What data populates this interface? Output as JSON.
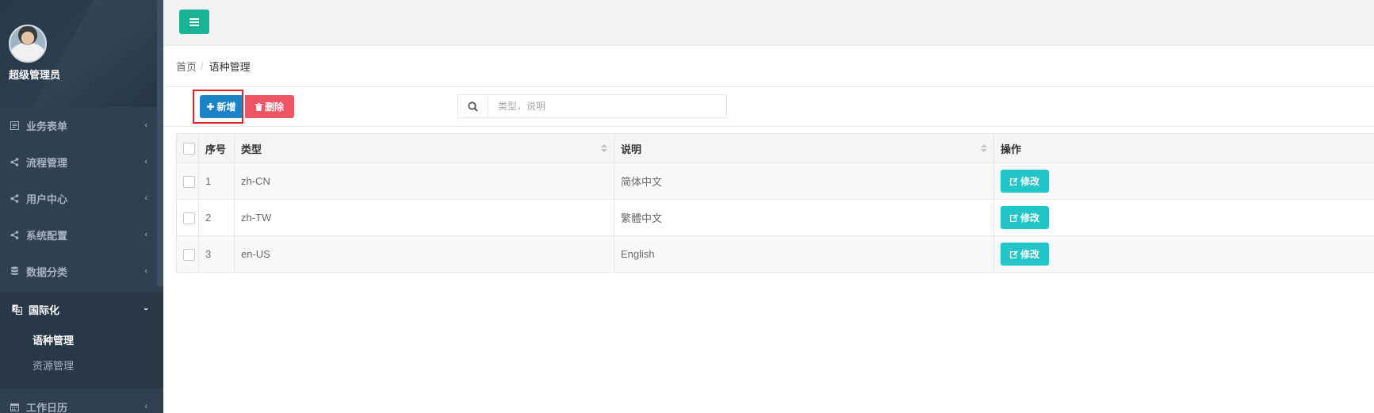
{
  "sidebar": {
    "username": "超级管理员",
    "items": [
      {
        "label": "业务表单",
        "icon": "form-icon"
      },
      {
        "label": "流程管理",
        "icon": "share-icon"
      },
      {
        "label": "用户中心",
        "icon": "share-icon"
      },
      {
        "label": "系统配置",
        "icon": "share-icon"
      },
      {
        "label": "数据分类",
        "icon": "database-icon"
      }
    ],
    "active": {
      "label": "国际化",
      "icon": "translate-icon"
    },
    "submenu": [
      {
        "label": "语种管理",
        "current": true
      },
      {
        "label": "资源管理",
        "current": false
      }
    ],
    "after": {
      "label": "工作日历",
      "icon": "calendar-icon"
    }
  },
  "breadcrumb": {
    "home": "首页",
    "sep": "/",
    "current": "语种管理"
  },
  "toolbar": {
    "add_label": "新增",
    "delete_label": "删除",
    "search_placeholder": "类型，说明"
  },
  "table": {
    "headers": {
      "no": "序号",
      "type": "类型",
      "desc": "说明",
      "action": "操作"
    },
    "rows": [
      {
        "no": "1",
        "type": "zh-CN",
        "desc": "简体中文",
        "action": "修改"
      },
      {
        "no": "2",
        "type": "zh-TW",
        "desc": "繁體中文",
        "action": "修改"
      },
      {
        "no": "3",
        "type": "en-US",
        "desc": "English",
        "action": "修改"
      }
    ]
  },
  "colors": {
    "sidebar_bg": "#2f4050",
    "primary": "#1c84c6",
    "danger": "#ed5565",
    "info": "#23c6c8",
    "toggle": "#1ab394",
    "highlight": "#e0262a"
  }
}
